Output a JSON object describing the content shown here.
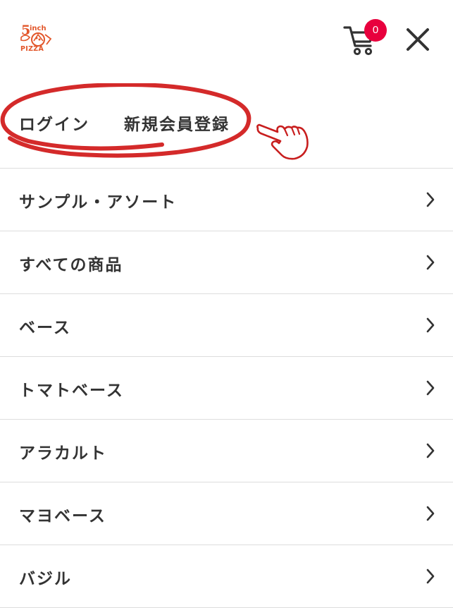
{
  "header": {
    "logo": {
      "number": "5",
      "unit": "inch",
      "word": "PIZZA"
    },
    "cart": {
      "count": "0",
      "icon": "cart-icon"
    },
    "close_icon": "close-icon"
  },
  "auth": {
    "login_label": "ログイン",
    "register_label": "新規会員登録"
  },
  "menu": {
    "items": [
      {
        "label": "サンプル・アソート"
      },
      {
        "label": "すべての商品"
      },
      {
        "label": "ベース"
      },
      {
        "label": "トマトベース"
      },
      {
        "label": "アラカルト"
      },
      {
        "label": "マヨベース"
      },
      {
        "label": "バジル"
      }
    ]
  },
  "colors": {
    "accent": "#e8003d",
    "annotation_red": "#d42a2a",
    "logo_orange": "#e2562a",
    "text": "#333333",
    "divider": "#dddddd"
  }
}
